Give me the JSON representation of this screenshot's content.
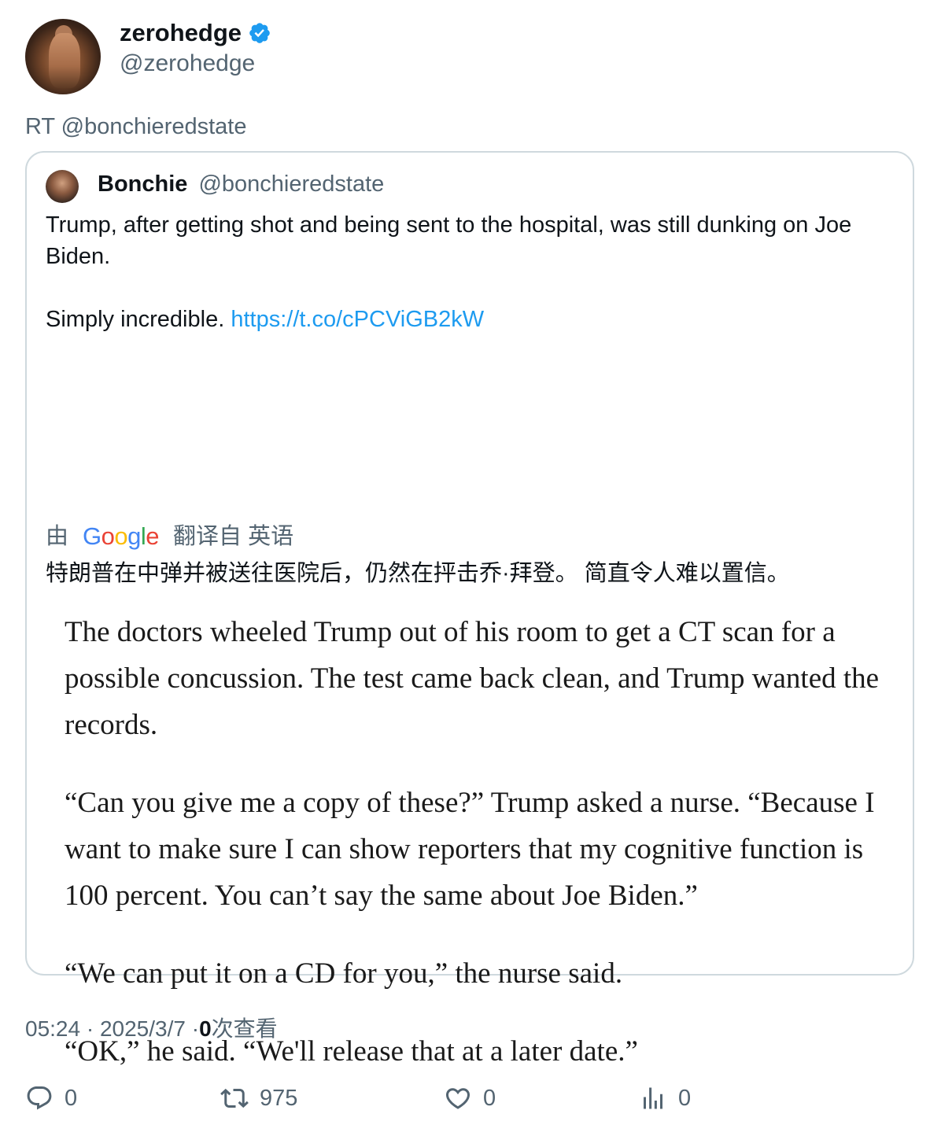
{
  "retweeter": {
    "name": "zerohedge",
    "handle": "@zerohedge",
    "verified": true,
    "verified_color": "#1d9bf0"
  },
  "retweet_line": "RT @bonchieredstate",
  "quote": {
    "author_name": "Bonchie",
    "author_handle": "@bonchieredstate",
    "text_line1": "Trump, after getting shot and being sent to the hospital, was still dunking on Joe Biden.",
    "text_line2_prefix": "Simply incredible.",
    "link": "https://t.co/cPCViGB2kW",
    "translate_prefix": "由",
    "translate_brand": "Google",
    "translate_suffix": "翻译自 英语",
    "translated_text": "特朗普在中弹并被送往医院后，仍然在抨击乔·拜登。 简直令人难以置信。",
    "excerpt": [
      "The doctors wheeled Trump out of his room to get a CT scan for a possible concussion. The test came back clean, and Trump wanted the records.",
      "“Can you give me a copy of these?” Trump asked a nurse. “Because I want to make sure I can show reporters that my cognitive function is 100 percent. You can’t say the same about Joe Biden.”",
      "“We can put it on a CD for you,” the nurse said.",
      "“OK,” he said. “We'll release that at a later date.”"
    ]
  },
  "meta": {
    "time": "05:24",
    "separator": "·",
    "date": "2025/3/7",
    "views_count": "0",
    "views_label": "次查看"
  },
  "actions": {
    "reply_count": "0",
    "retweet_count": "975",
    "like_count": "0",
    "views_count": "0"
  },
  "colors": {
    "link": "#1d9bf0",
    "secondary_text": "#536471",
    "border": "#cfd9de"
  }
}
